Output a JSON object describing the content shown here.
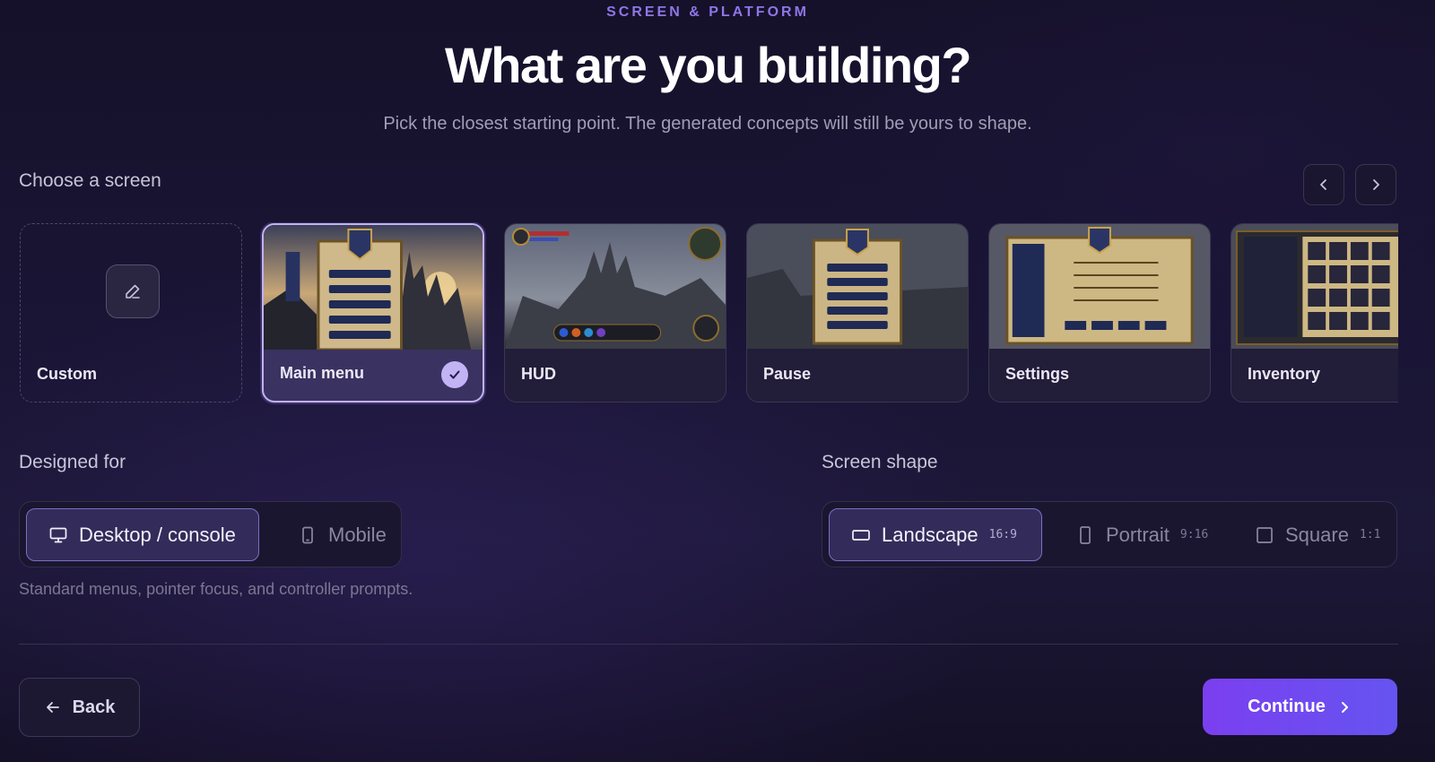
{
  "header": {
    "eyebrow": "SCREEN & PLATFORM",
    "title": "What are you building?",
    "subtitle": "Pick the closest starting point. The generated concepts will still be yours to shape."
  },
  "screen_picker": {
    "label": "Choose a screen",
    "selected": "Main menu",
    "cards": [
      {
        "label": "Custom",
        "icon": "pencil-icon"
      },
      {
        "label": "Main menu",
        "selected": true
      },
      {
        "label": "HUD"
      },
      {
        "label": "Pause"
      },
      {
        "label": "Settings"
      },
      {
        "label": "Inventory"
      }
    ]
  },
  "designed_for": {
    "label": "Designed for",
    "options": [
      {
        "label": "Desktop / console",
        "icon": "monitor-icon",
        "active": true
      },
      {
        "label": "Mobile",
        "icon": "phone-icon",
        "active": false
      }
    ],
    "hint": "Standard menus, pointer focus, and controller prompts."
  },
  "screen_shape": {
    "label": "Screen shape",
    "options": [
      {
        "label": "Landscape",
        "ratio": "16:9",
        "icon": "landscape-icon",
        "active": true
      },
      {
        "label": "Portrait",
        "ratio": "9:16",
        "icon": "portrait-icon",
        "active": false
      },
      {
        "label": "Square",
        "ratio": "1:1",
        "icon": "square-icon",
        "active": false
      }
    ]
  },
  "footer": {
    "back_label": "Back",
    "continue_label": "Continue"
  },
  "colors": {
    "accent": "#8f76e6",
    "primary_button": "#7b3ff0",
    "selected_badge": "#c2b3f5"
  }
}
